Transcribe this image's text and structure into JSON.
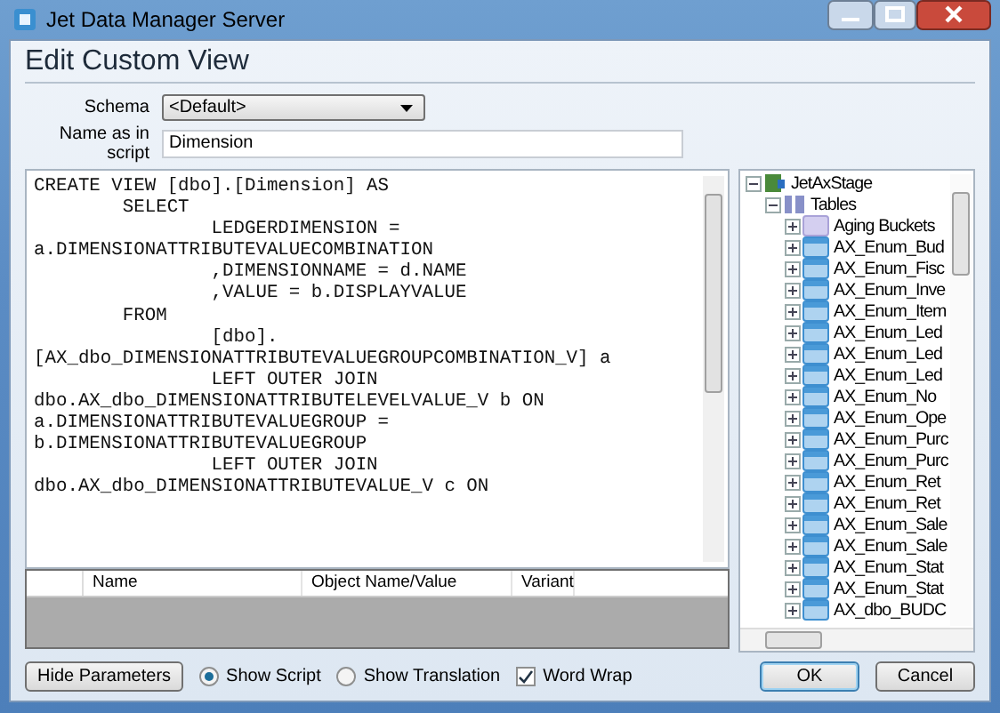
{
  "window": {
    "title": "Jet Data Manager Server"
  },
  "heading": "Edit Custom View",
  "schema": {
    "label": "Schema",
    "value": "<Default>"
  },
  "name_field": {
    "label": "Name as in script",
    "value": "Dimension"
  },
  "script": "CREATE VIEW [dbo].[Dimension] AS\n        SELECT\n                LEDGERDIMENSION =\na.DIMENSIONATTRIBUTEVALUECOMBINATION\n                ,DIMENSIONNAME = d.NAME\n                ,VALUE = b.DISPLAYVALUE\n        FROM\n                [dbo].\n[AX_dbo_DIMENSIONATTRIBUTEVALUEGROUPCOMBINATION_V] a\n                LEFT OUTER JOIN\ndbo.AX_dbo_DIMENSIONATTRIBUTELEVELVALUE_V b ON\na.DIMENSIONATTRIBUTEVALUEGROUP =\nb.DIMENSIONATTRIBUTEVALUEGROUP\n                LEFT OUTER JOIN\ndbo.AX_dbo_DIMENSIONATTRIBUTEVALUE_V c ON",
  "tree": [
    {
      "label": "JetAxStage",
      "kind": "database",
      "expanded": true,
      "children": [
        {
          "label": "Tables",
          "kind": "folder",
          "expanded": true,
          "children": [
            {
              "label": "Aging Buckets",
              "kind": "custom",
              "expanded": false
            },
            {
              "label": "AX_Enum_Bud",
              "kind": "table",
              "expanded": false
            },
            {
              "label": "AX_Enum_Fisc",
              "kind": "table",
              "expanded": false
            },
            {
              "label": "AX_Enum_Inve",
              "kind": "table",
              "expanded": false
            },
            {
              "label": "AX_Enum_Item",
              "kind": "table",
              "expanded": false
            },
            {
              "label": "AX_Enum_Led",
              "kind": "table",
              "expanded": false
            },
            {
              "label": "AX_Enum_Led",
              "kind": "table",
              "expanded": false
            },
            {
              "label": "AX_Enum_Led",
              "kind": "table",
              "expanded": false
            },
            {
              "label": "AX_Enum_No",
              "kind": "table",
              "expanded": false
            },
            {
              "label": "AX_Enum_Ope",
              "kind": "table",
              "expanded": false
            },
            {
              "label": "AX_Enum_Purc",
              "kind": "table",
              "expanded": false
            },
            {
              "label": "AX_Enum_Purc",
              "kind": "table",
              "expanded": false
            },
            {
              "label": "AX_Enum_Ret",
              "kind": "table",
              "expanded": false
            },
            {
              "label": "AX_Enum_Ret",
              "kind": "table",
              "expanded": false
            },
            {
              "label": "AX_Enum_Sale",
              "kind": "table",
              "expanded": false
            },
            {
              "label": "AX_Enum_Sale",
              "kind": "table",
              "expanded": false
            },
            {
              "label": "AX_Enum_Stat",
              "kind": "table",
              "expanded": false
            },
            {
              "label": "AX_Enum_Stat",
              "kind": "table",
              "expanded": false
            },
            {
              "label": "AX_dbo_BUDC",
              "kind": "table",
              "expanded": false
            }
          ]
        }
      ]
    }
  ],
  "parameters_table": {
    "columns": [
      "Name",
      "Object Name/Value",
      "Variant"
    ]
  },
  "hide_parameters_button": "Hide Parameters",
  "view_options": [
    {
      "label": "Show Script",
      "selected": true
    },
    {
      "label": "Show Translation",
      "selected": false
    }
  ],
  "word_wrap": {
    "label": "Word Wrap",
    "checked": true
  },
  "buttons": [
    "OK",
    "Cancel"
  ]
}
